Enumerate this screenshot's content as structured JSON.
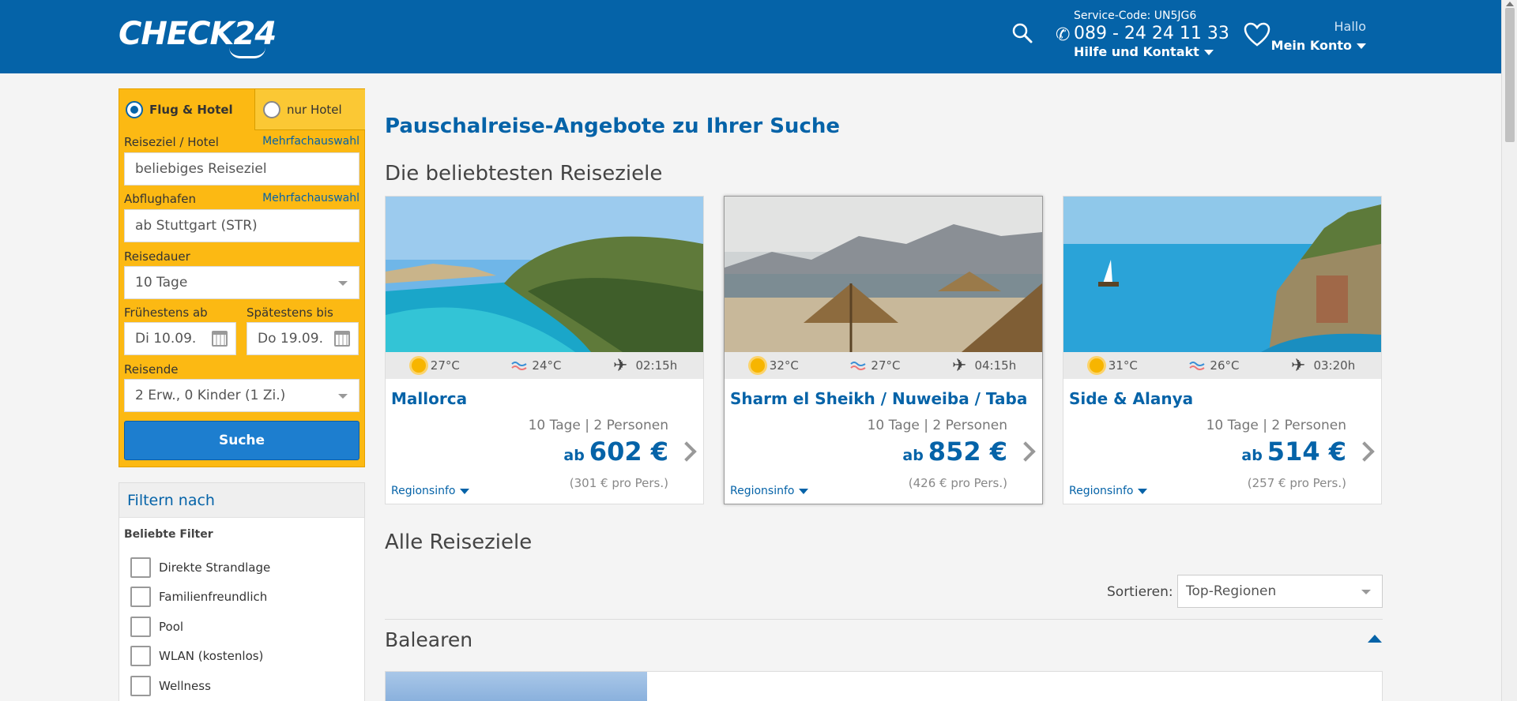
{
  "header": {
    "logo": "CHECK24",
    "service_code": "Service-Code: UN5JG6",
    "phone": "089 - 24 24 11 33",
    "help": "Hilfe und Kontakt",
    "hallo": "Hallo",
    "account": "Mein Konto"
  },
  "search_form": {
    "tab_flight_hotel": "Flug & Hotel",
    "tab_hotel_only": "nur Hotel",
    "destination_label": "Reiseziel / Hotel",
    "destination_multi": "Mehrfachauswahl",
    "destination_value": "beliebiges Reiseziel",
    "airport_label": "Abflughafen",
    "airport_multi": "Mehrfachauswahl",
    "airport_value": "ab Stuttgart (STR)",
    "duration_label": "Reisedauer",
    "duration_value": "10 Tage",
    "earliest_label": "Frühestens ab",
    "earliest_value": "Di 10.09.",
    "latest_label": "Spätestens bis",
    "latest_value": "Do 19.09.",
    "travelers_label": "Reisende",
    "travelers_value": "2 Erw., 0 Kinder (1 Zi.)",
    "search_button": "Suche"
  },
  "filters": {
    "title": "Filtern nach",
    "subtitle": "Beliebte Filter",
    "items": [
      "Direkte Strandlage",
      "Familienfreundlich",
      "Pool",
      "WLAN (kostenlos)",
      "Wellness"
    ]
  },
  "main": {
    "title": "Pauschalreise-Angebote zu Ihrer Suche",
    "popular_title": "Die beliebtesten Reiseziele",
    "all_title": "Alle Reiseziele",
    "sort_label": "Sortieren:",
    "sort_value": "Top-Regionen",
    "region_section": "Balearen"
  },
  "cards": [
    {
      "name": "Mallorca",
      "air_temp": "27°C",
      "water_temp": "24°C",
      "flight_time": "02:15h",
      "duration": "10 Tage | 2 Personen",
      "ab": "ab",
      "price": "602 €",
      "per_person": "(301 € pro Pers.)",
      "region_info": "Regionsinfo"
    },
    {
      "name": "Sharm el Sheikh / Nuweiba / Taba",
      "air_temp": "32°C",
      "water_temp": "27°C",
      "flight_time": "04:15h",
      "duration": "10 Tage | 2 Personen",
      "ab": "ab",
      "price": "852 €",
      "per_person": "(426 € pro Pers.)",
      "region_info": "Regionsinfo"
    },
    {
      "name": "Side & Alanya",
      "air_temp": "31°C",
      "water_temp": "26°C",
      "flight_time": "03:20h",
      "duration": "10 Tage | 2 Personen",
      "ab": "ab",
      "price": "514 €",
      "per_person": "(257 € pro Pers.)",
      "region_info": "Regionsinfo"
    }
  ],
  "colors": {
    "brand_blue": "#0563a8",
    "form_yellow": "#fcb913",
    "button_blue": "#1d7ecf"
  },
  "icons": [
    "search-icon",
    "phone-icon",
    "heart-icon",
    "sun-icon",
    "water-icon",
    "plane-icon",
    "calendar-icon",
    "chevron-right-icon"
  ]
}
